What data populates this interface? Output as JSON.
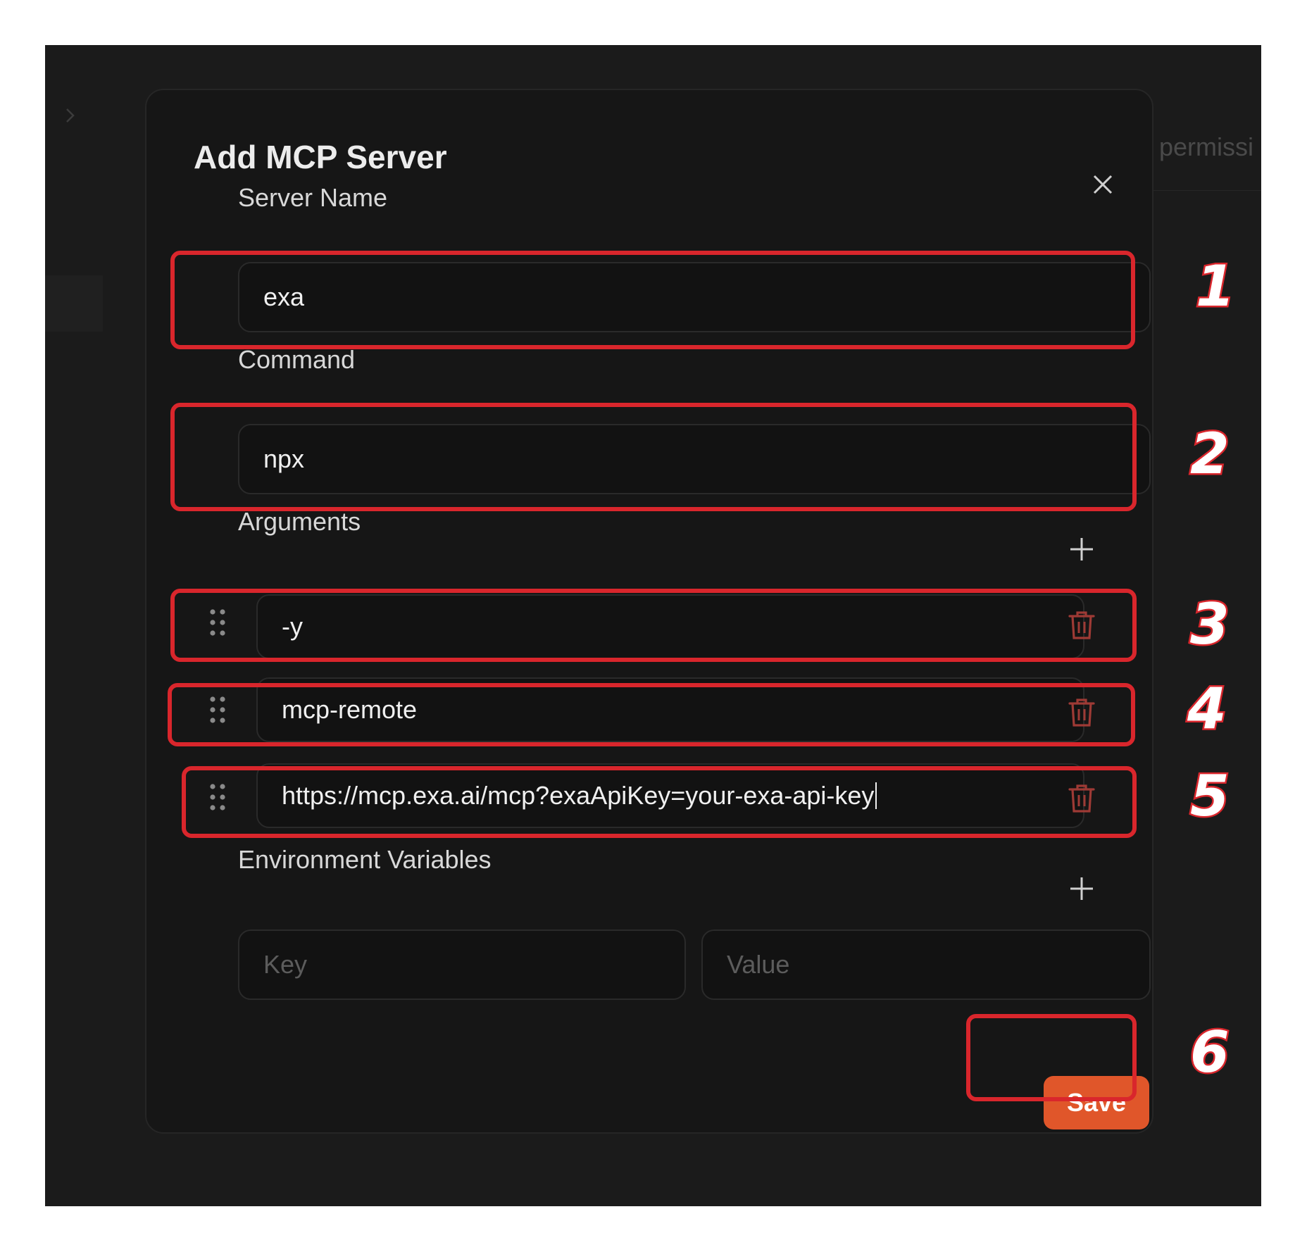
{
  "background": {
    "partial_text": "permissi"
  },
  "modal": {
    "title": "Add MCP Server",
    "server_name": {
      "label": "Server Name",
      "value": "exa"
    },
    "command": {
      "label": "Command",
      "value": "npx"
    },
    "arguments": {
      "label": "Arguments",
      "items": [
        "-y",
        "mcp-remote",
        "https://mcp.exa.ai/mcp?exaApiKey=your-exa-api-key"
      ]
    },
    "environment": {
      "label": "Environment Variables",
      "key_placeholder": "Key",
      "value_placeholder": "Value"
    },
    "save_label": "Save"
  },
  "annotations": [
    "1",
    "2",
    "3",
    "4",
    "5",
    "6"
  ],
  "colors": {
    "screen_bg": "#1b1b1b",
    "modal_bg": "#161616",
    "save_button": "#e0562a",
    "trash_icon": "#9e3a35",
    "annotation": "#d9262c"
  },
  "icons": [
    "chevron-right-icon",
    "close-icon",
    "plus-icon",
    "drag-handle-icon",
    "trash-icon"
  ]
}
